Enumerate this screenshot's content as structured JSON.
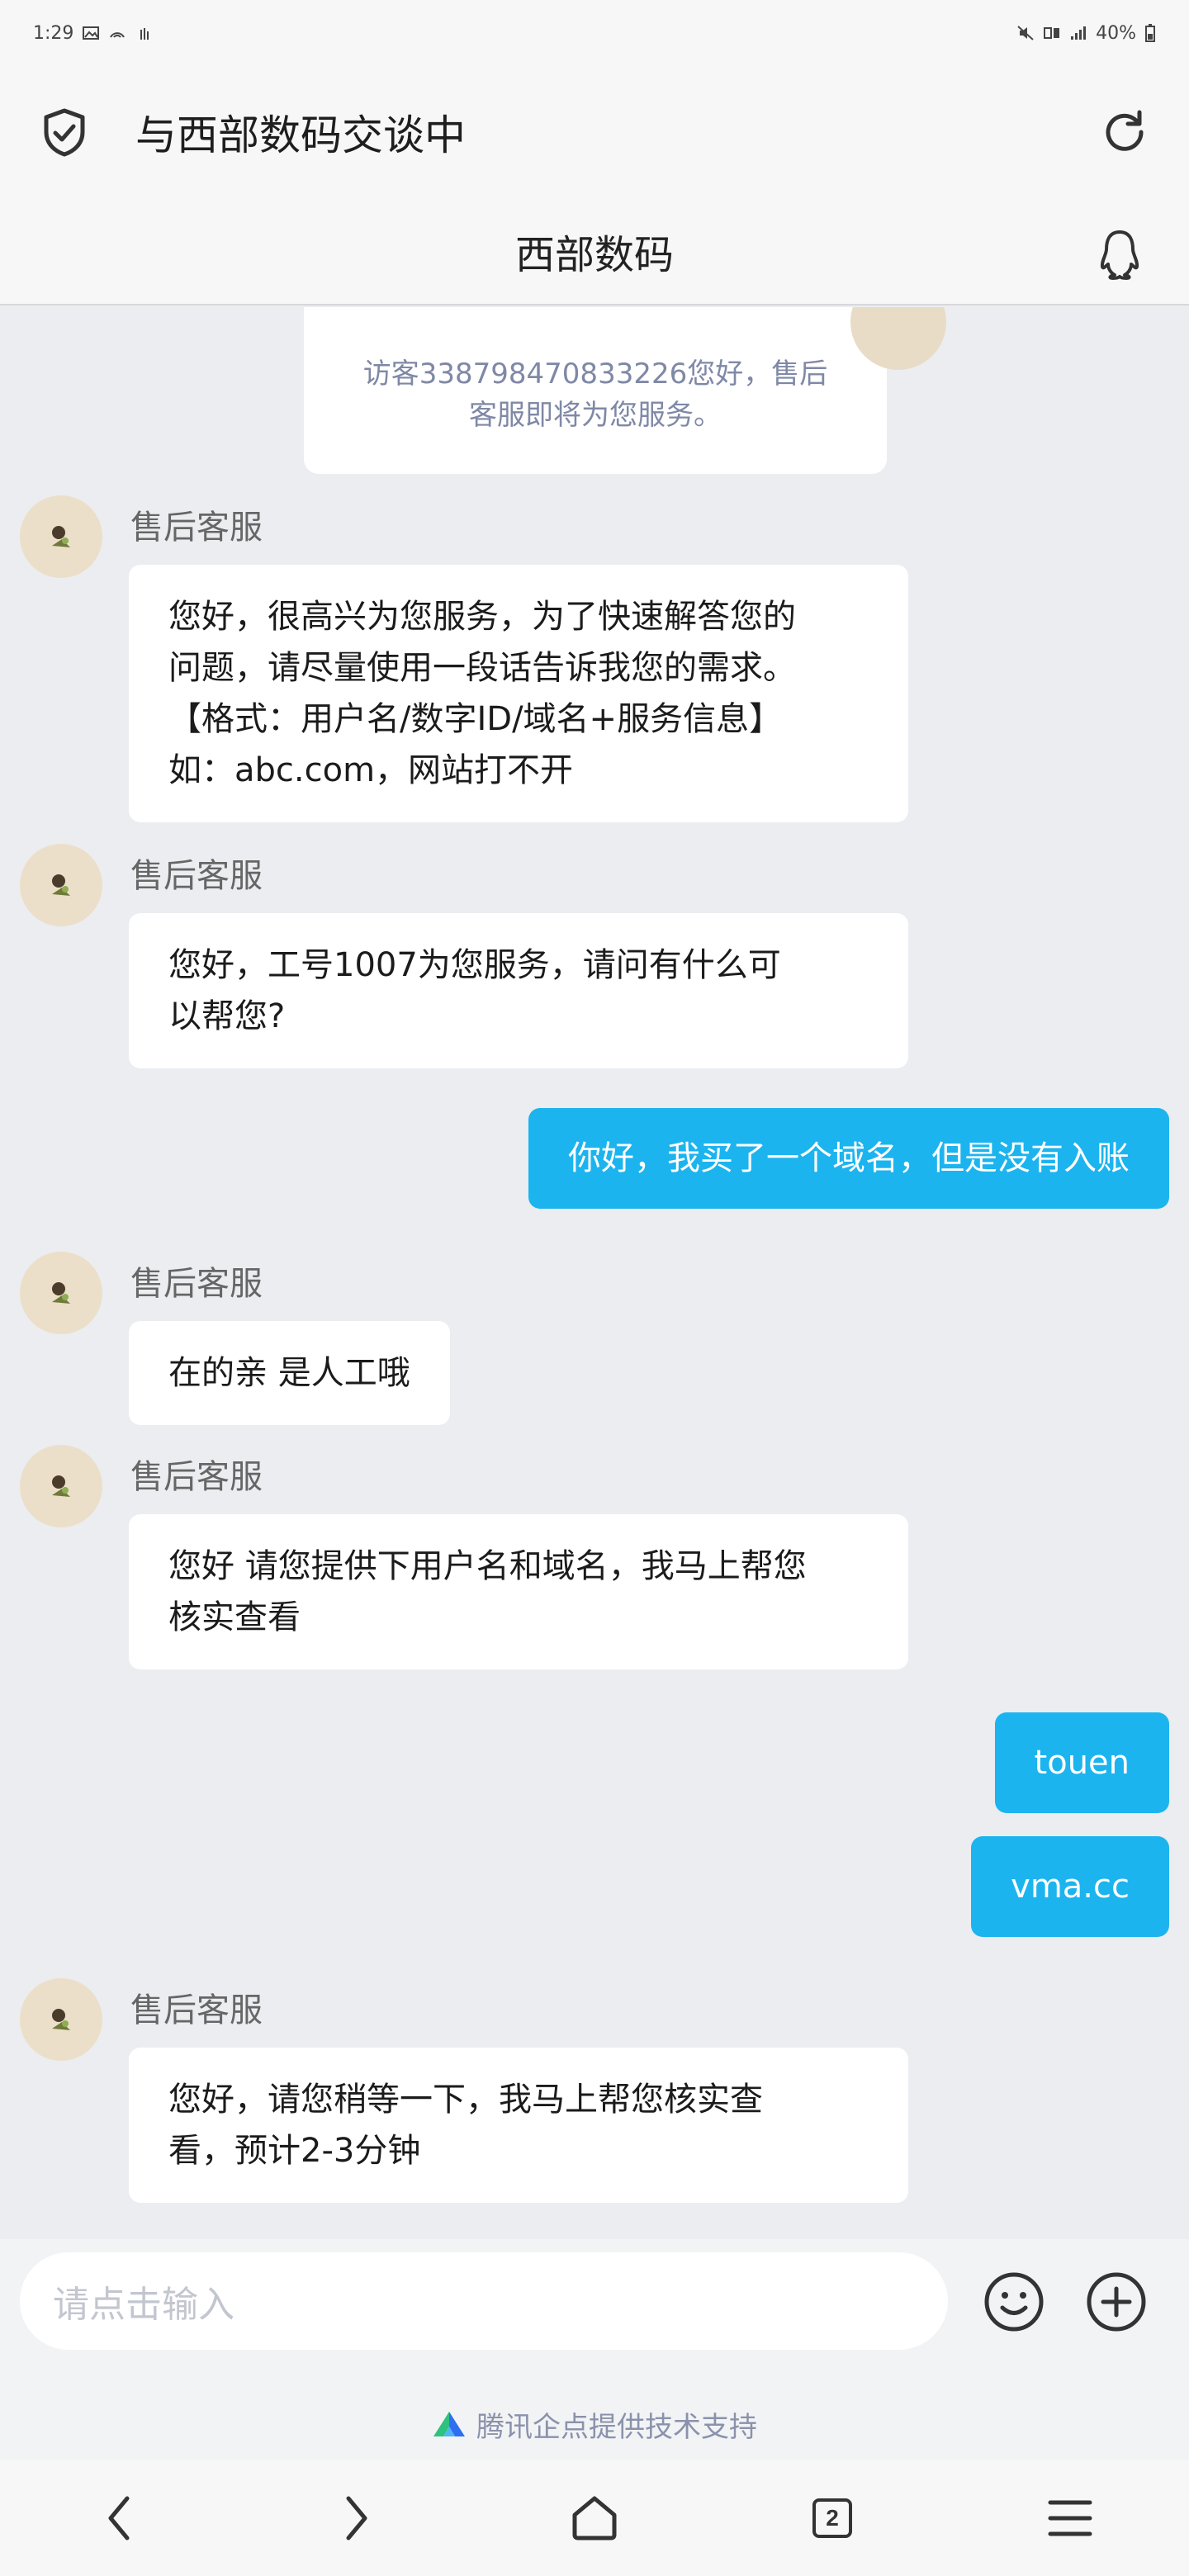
{
  "status_bar": {
    "time": "1:29",
    "battery": "40%"
  },
  "browser": {
    "title": "与西部数码交谈中"
  },
  "chat": {
    "title": "西部数码"
  },
  "system_message": {
    "text_line1": "访客338798470833226您好，售后",
    "text_line2": "客服即将为您服务。"
  },
  "messages": [
    {
      "sender": "售后客服",
      "lines": [
        "您好，很高兴为您服务，为了快速解答您的",
        "问题，请尽量使用一段话告诉我您的需求。",
        "【格式：用户名/数字ID/域名+服务信息】",
        "如：abc.com，网站打不开"
      ]
    },
    {
      "sender": "售后客服",
      "lines": [
        "您好，工号1007为您服务，请问有什么可",
        "以帮您?"
      ]
    },
    {
      "outgoing": "你好，我买了一个域名，但是没有入账"
    },
    {
      "sender": "售后客服",
      "lines": [
        "在的亲 是人工哦"
      ]
    },
    {
      "sender": "售后客服",
      "lines": [
        "您好 请您提供下用户名和域名，我马上帮您",
        "核实查看"
      ]
    },
    {
      "outgoing": "touen"
    },
    {
      "outgoing": "vma.cc"
    },
    {
      "sender": "售后客服",
      "lines": [
        "您好，请您稍等一下，我马上帮您核实查",
        "看，预计2-3分钟"
      ]
    }
  ],
  "input": {
    "placeholder": "请点击输入"
  },
  "footer": {
    "powered_by": "腾讯企点提供技术支持"
  },
  "nav": {
    "tab_count": "2"
  },
  "colors": {
    "accent": "#1cb4ef",
    "background": "#ebedf1"
  }
}
